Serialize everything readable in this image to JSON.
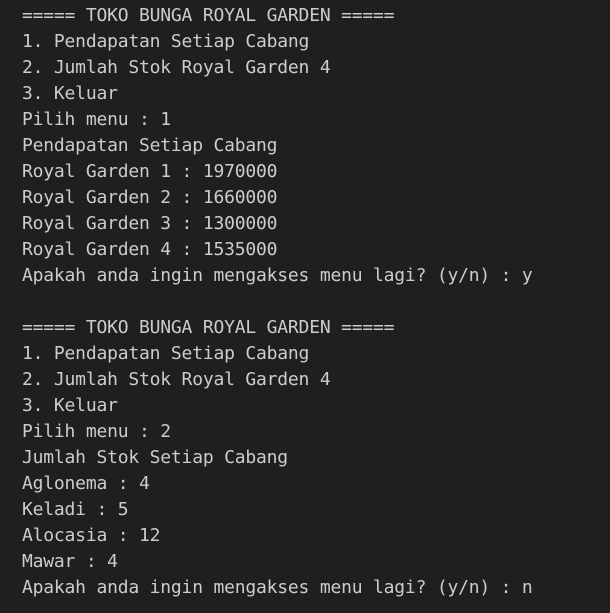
{
  "terminal": {
    "lines": [
      "===== TOKO BUNGA ROYAL GARDEN =====",
      "1. Pendapatan Setiap Cabang",
      "2. Jumlah Stok Royal Garden 4",
      "3. Keluar",
      "Pilih menu : 1",
      "Pendapatan Setiap Cabang",
      "Royal Garden 1 : 1970000",
      "Royal Garden 2 : 1660000",
      "Royal Garden 3 : 1300000",
      "Royal Garden 4 : 1535000",
      "Apakah anda ingin mengakses menu lagi? (y/n) : y",
      "",
      "===== TOKO BUNGA ROYAL GARDEN =====",
      "1. Pendapatan Setiap Cabang",
      "2. Jumlah Stok Royal Garden 4",
      "3. Keluar",
      "Pilih menu : 2",
      "Jumlah Stok Setiap Cabang",
      "Aglonema : 4",
      "Keladi : 5",
      "Alocasia : 12",
      "Mawar : 4",
      "Apakah anda ingin mengakses menu lagi? (y/n) : n"
    ]
  },
  "colors": {
    "background": "#1f1f1f",
    "text": "#cccccc"
  }
}
